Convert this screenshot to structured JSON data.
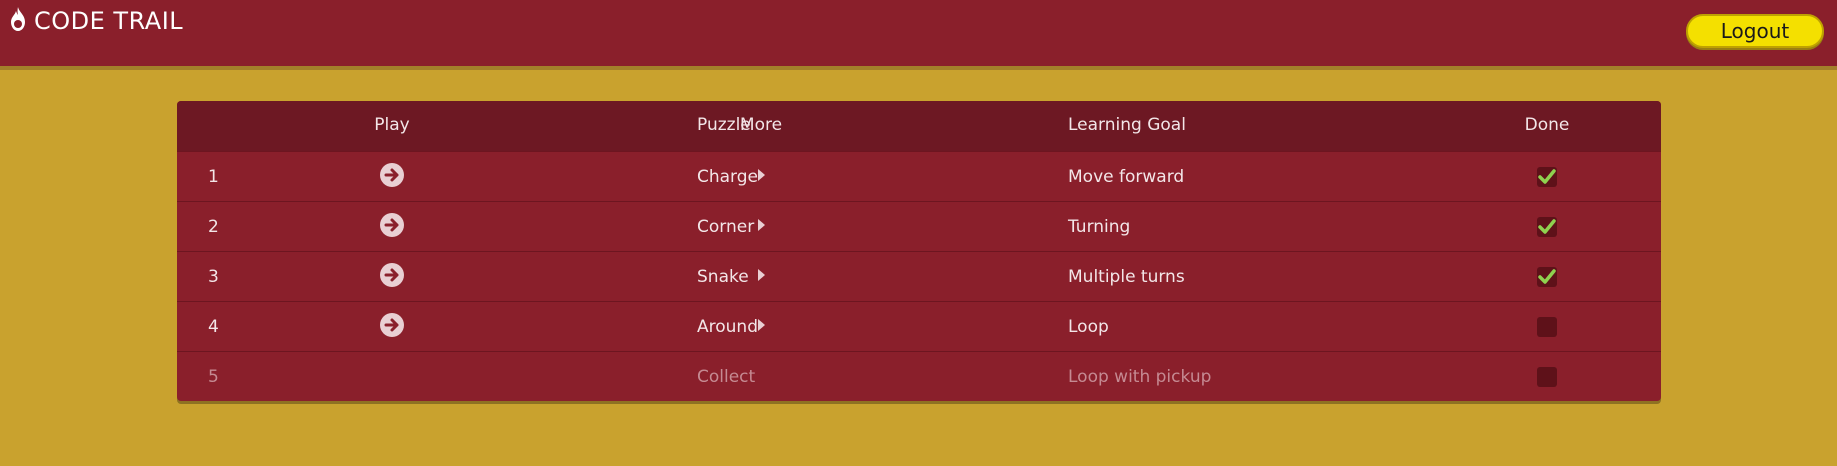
{
  "header": {
    "title": "CODE TRAIL",
    "logout_label": "Logout"
  },
  "table": {
    "columns": {
      "number": "",
      "play": "Play",
      "more": "More",
      "puzzle": "Puzzle",
      "learning_goal": "Learning Goal",
      "done": "Done"
    },
    "rows": [
      {
        "number": "1",
        "puzzle": "Charge",
        "learning_goal": "Move forward",
        "done": true,
        "locked": false
      },
      {
        "number": "2",
        "puzzle": "Corner",
        "learning_goal": "Turning",
        "done": true,
        "locked": false
      },
      {
        "number": "3",
        "puzzle": "Snake",
        "learning_goal": "Multiple turns",
        "done": true,
        "locked": false
      },
      {
        "number": "4",
        "puzzle": "Around",
        "learning_goal": "Loop",
        "done": false,
        "locked": false
      },
      {
        "number": "5",
        "puzzle": "Collect",
        "learning_goal": "Loop with pickup",
        "done": false,
        "locked": true
      }
    ]
  },
  "colors": {
    "topbar": "#8a1f2b",
    "background": "#c9a22e",
    "logout_button": "#f4e000",
    "check": "#8fd14f"
  },
  "icons": {
    "brand": "flame-icon",
    "play": "arrow-circle-right-icon",
    "more": "caret-right-icon",
    "done": "check-icon"
  }
}
